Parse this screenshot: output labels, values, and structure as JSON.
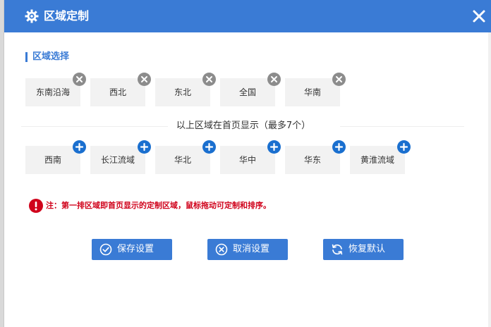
{
  "dialog": {
    "title": "区域定制",
    "icons": {
      "title": "gear-icon",
      "close": "close-icon"
    },
    "colors": {
      "accent": "#3a7bd5",
      "badge_remove": "#8c8c8c",
      "badge_add": "#1a6fcf",
      "warning": "#d0021b"
    }
  },
  "section": {
    "title": "区域选择"
  },
  "selected_regions": [
    {
      "label": "东南沿海",
      "badge": "remove-icon"
    },
    {
      "label": "西北",
      "badge": "remove-icon"
    },
    {
      "label": "东北",
      "badge": "remove-icon"
    },
    {
      "label": "全国",
      "badge": "remove-icon"
    },
    {
      "label": "华南",
      "badge": "remove-icon"
    }
  ],
  "divider": {
    "text": "以上区域在首页显示（最多7个）"
  },
  "available_regions": [
    {
      "label": "西南",
      "badge": "add-icon"
    },
    {
      "label": "长江流域",
      "badge": "add-icon"
    },
    {
      "label": "华北",
      "badge": "add-icon"
    },
    {
      "label": "华中",
      "badge": "add-icon"
    },
    {
      "label": "华东",
      "badge": "add-icon"
    },
    {
      "label": "黄淮流域",
      "badge": "add-icon"
    }
  ],
  "note": {
    "text": "注：第一排区域即首页显示的定制区域，鼠标拖动可定制和排序。",
    "icon": "exclamation-icon"
  },
  "actions": {
    "save": {
      "label": "保存设置",
      "icon": "check-circle-icon"
    },
    "cancel": {
      "label": "取消设置",
      "icon": "x-circle-icon"
    },
    "reset": {
      "label": "恢复默认",
      "icon": "refresh-icon"
    }
  }
}
